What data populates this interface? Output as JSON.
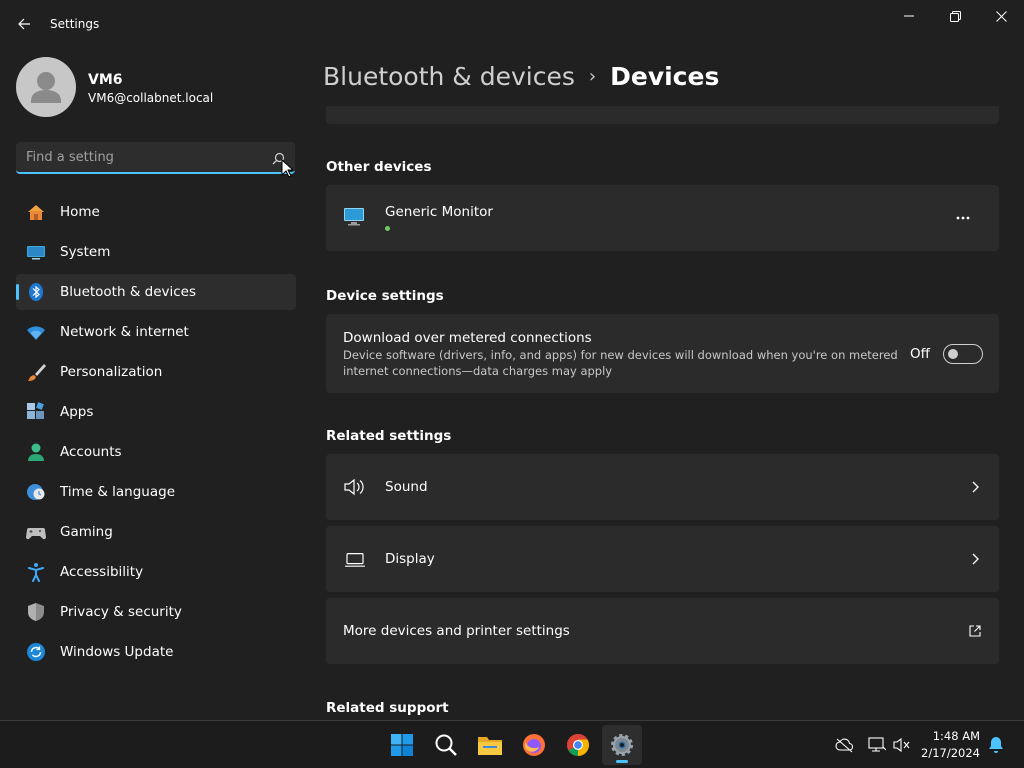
{
  "window": {
    "title": "Settings"
  },
  "profile": {
    "name": "VM6",
    "email": "VM6@collabnet.local"
  },
  "search": {
    "placeholder": "Find a setting",
    "value": ""
  },
  "nav": {
    "items": [
      {
        "label": "Home",
        "icon": "home-icon"
      },
      {
        "label": "System",
        "icon": "system-icon"
      },
      {
        "label": "Bluetooth & devices",
        "icon": "bluetooth-icon",
        "active": true
      },
      {
        "label": "Network & internet",
        "icon": "wifi-icon"
      },
      {
        "label": "Personalization",
        "icon": "brush-icon"
      },
      {
        "label": "Apps",
        "icon": "apps-icon"
      },
      {
        "label": "Accounts",
        "icon": "accounts-icon"
      },
      {
        "label": "Time & language",
        "icon": "time-language-icon"
      },
      {
        "label": "Gaming",
        "icon": "gaming-icon"
      },
      {
        "label": "Accessibility",
        "icon": "accessibility-icon"
      },
      {
        "label": "Privacy & security",
        "icon": "shield-icon"
      },
      {
        "label": "Windows Update",
        "icon": "update-icon"
      }
    ]
  },
  "header": {
    "parent": "Bluetooth & devices",
    "separator": "›",
    "current": "Devices"
  },
  "other_devices": {
    "title": "Other devices",
    "device": {
      "name": "Generic Monitor",
      "status_color": "#6ccb5f"
    }
  },
  "device_settings": {
    "title": "Device settings",
    "metered": {
      "title": "Download over metered connections",
      "line1": "Device software (drivers, info, and apps) for new devices will download when you're on metered",
      "line2": "internet connections—data charges may apply",
      "toggle_label": "Off",
      "on": false
    }
  },
  "related_settings": {
    "title": "Related settings",
    "sound": "Sound",
    "display": "Display",
    "printers": "More devices and printer settings"
  },
  "related_support": {
    "title": "Related support"
  },
  "taskbar": {
    "time": "1:48 AM",
    "date": "2/17/2024"
  },
  "colors": {
    "accent": "#4cc2ff",
    "background": "#202020",
    "card": "#2b2b2b"
  }
}
